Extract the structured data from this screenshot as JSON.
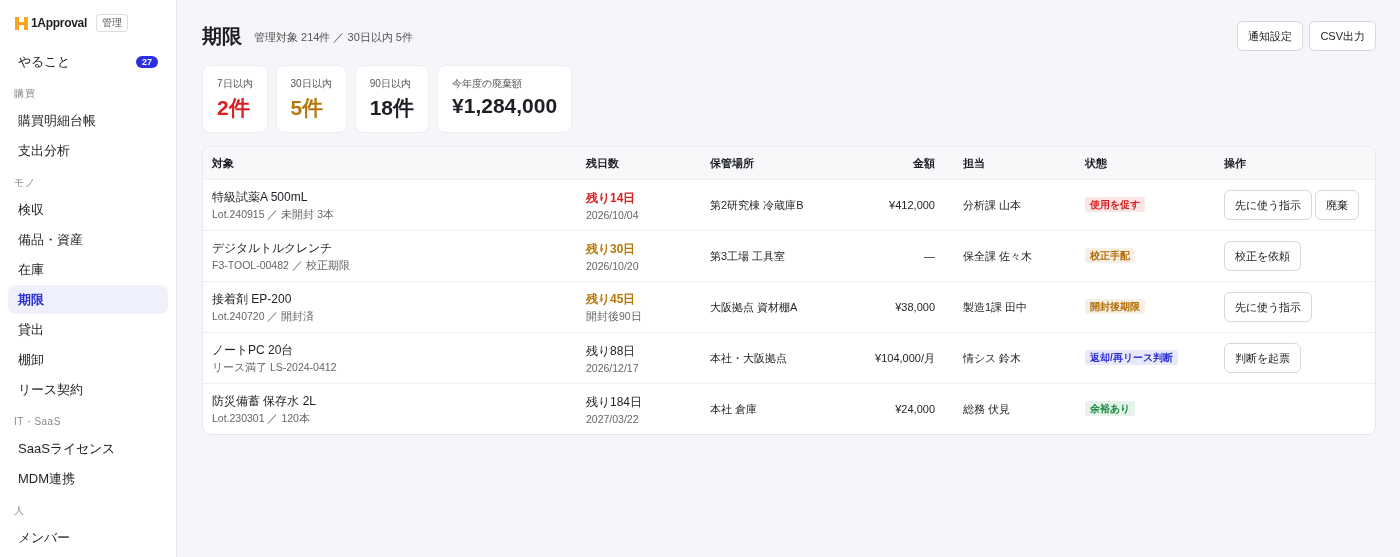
{
  "brand": {
    "name": "1Approval",
    "tag": "管理"
  },
  "nav": [
    {
      "kind": "item",
      "label": "やること",
      "selected": false,
      "badge": "27"
    },
    {
      "kind": "section",
      "label": "購買"
    },
    {
      "kind": "item",
      "label": "購買明細台帳",
      "selected": false
    },
    {
      "kind": "item",
      "label": "支出分析",
      "selected": false
    },
    {
      "kind": "section",
      "label": "モノ"
    },
    {
      "kind": "item",
      "label": "検収",
      "selected": false
    },
    {
      "kind": "item",
      "label": "備品・資産",
      "selected": false
    },
    {
      "kind": "item",
      "label": "在庫",
      "selected": false
    },
    {
      "kind": "item",
      "label": "期限",
      "selected": true
    },
    {
      "kind": "item",
      "label": "貸出",
      "selected": false
    },
    {
      "kind": "item",
      "label": "棚卸",
      "selected": false
    },
    {
      "kind": "item",
      "label": "リース契約",
      "selected": false
    },
    {
      "kind": "section",
      "label": "IT・SaaS"
    },
    {
      "kind": "item",
      "label": "SaaSライセンス",
      "selected": false
    },
    {
      "kind": "item",
      "label": "MDM連携",
      "selected": false
    },
    {
      "kind": "section",
      "label": "人"
    },
    {
      "kind": "item",
      "label": "メンバー",
      "selected": false
    }
  ],
  "page": {
    "title": "期限",
    "subtitle": "管理対象 214件 ／ 30日以内 5件",
    "actions": [
      "通知設定",
      "CSV出力"
    ]
  },
  "stats": [
    {
      "label": "7日以内",
      "value": "2件",
      "color": "#d81e1e"
    },
    {
      "label": "30日以内",
      "value": "5件",
      "color": "#b7770c"
    },
    {
      "label": "90日以内",
      "value": "18件",
      "color": "#1d1f24"
    },
    {
      "label": "今年度の廃棄額",
      "value": "¥1,284,000",
      "color": "#1d1f24"
    }
  ],
  "table": {
    "columns": [
      "対象",
      "残日数",
      "保管場所",
      "金額",
      "担当",
      "状態",
      "操作"
    ],
    "rows": [
      {
        "name": "特級試薬A 500mL",
        "detail": "Lot.240915 ／ 未開封 3本",
        "remaining": "残り14日",
        "date": "2026/10/04",
        "color": "#d81e1e",
        "urgent": true,
        "location": "第2研究棟 冷蔵庫B",
        "amount": "¥412,000",
        "owner": "分析課 山本",
        "status": {
          "label": "使用を促す",
          "color": "#d81e1e"
        },
        "actions": [
          "先に使う指示",
          "廃棄"
        ]
      },
      {
        "name": "デジタルトルクレンチ",
        "detail": "F3-TOOL-00482 ／ 校正期限",
        "remaining": "残り30日",
        "date": "2026/10/20",
        "color": "#b7770c",
        "urgent": true,
        "location": "第3工場 工具室",
        "amount": "—",
        "owner": "保全課 佐々木",
        "status": {
          "label": "校正手配",
          "color": "#b06c08"
        },
        "actions": [
          "校正を依頼"
        ]
      },
      {
        "name": "接着剤 EP-200",
        "detail": "Lot.240720 ／ 開封済",
        "remaining": "残り45日",
        "date": "開封後90日",
        "color": "#b7770c",
        "urgent": true,
        "location": "大阪拠点 資材棚A",
        "amount": "¥38,000",
        "owner": "製造1課 田中",
        "status": {
          "label": "開封後期限",
          "color": "#b06c08"
        },
        "actions": [
          "先に使う指示"
        ]
      },
      {
        "name": "ノートPC 20台",
        "detail": "リース満了 LS-2024-0412",
        "remaining": "残り88日",
        "date": "2026/12/17",
        "color": "#1d1f24",
        "urgent": false,
        "location": "本社・大阪拠点",
        "amount": "¥104,000/月",
        "owner": "情シス 鈴木",
        "status": {
          "label": "返却/再リース判断",
          "color": "#2b2fd6"
        },
        "actions": [
          "判断を起票"
        ]
      },
      {
        "name": "防災備蓄 保存水 2L",
        "detail": "Lot.230301 ／ 120本",
        "remaining": "残り184日",
        "date": "2027/03/22",
        "color": "#1d1f24",
        "urgent": false,
        "location": "本社 倉庫",
        "amount": "¥24,000",
        "owner": "総務 伏見",
        "status": {
          "label": "余裕あり",
          "color": "#168a3d"
        }
      }
    ]
  }
}
